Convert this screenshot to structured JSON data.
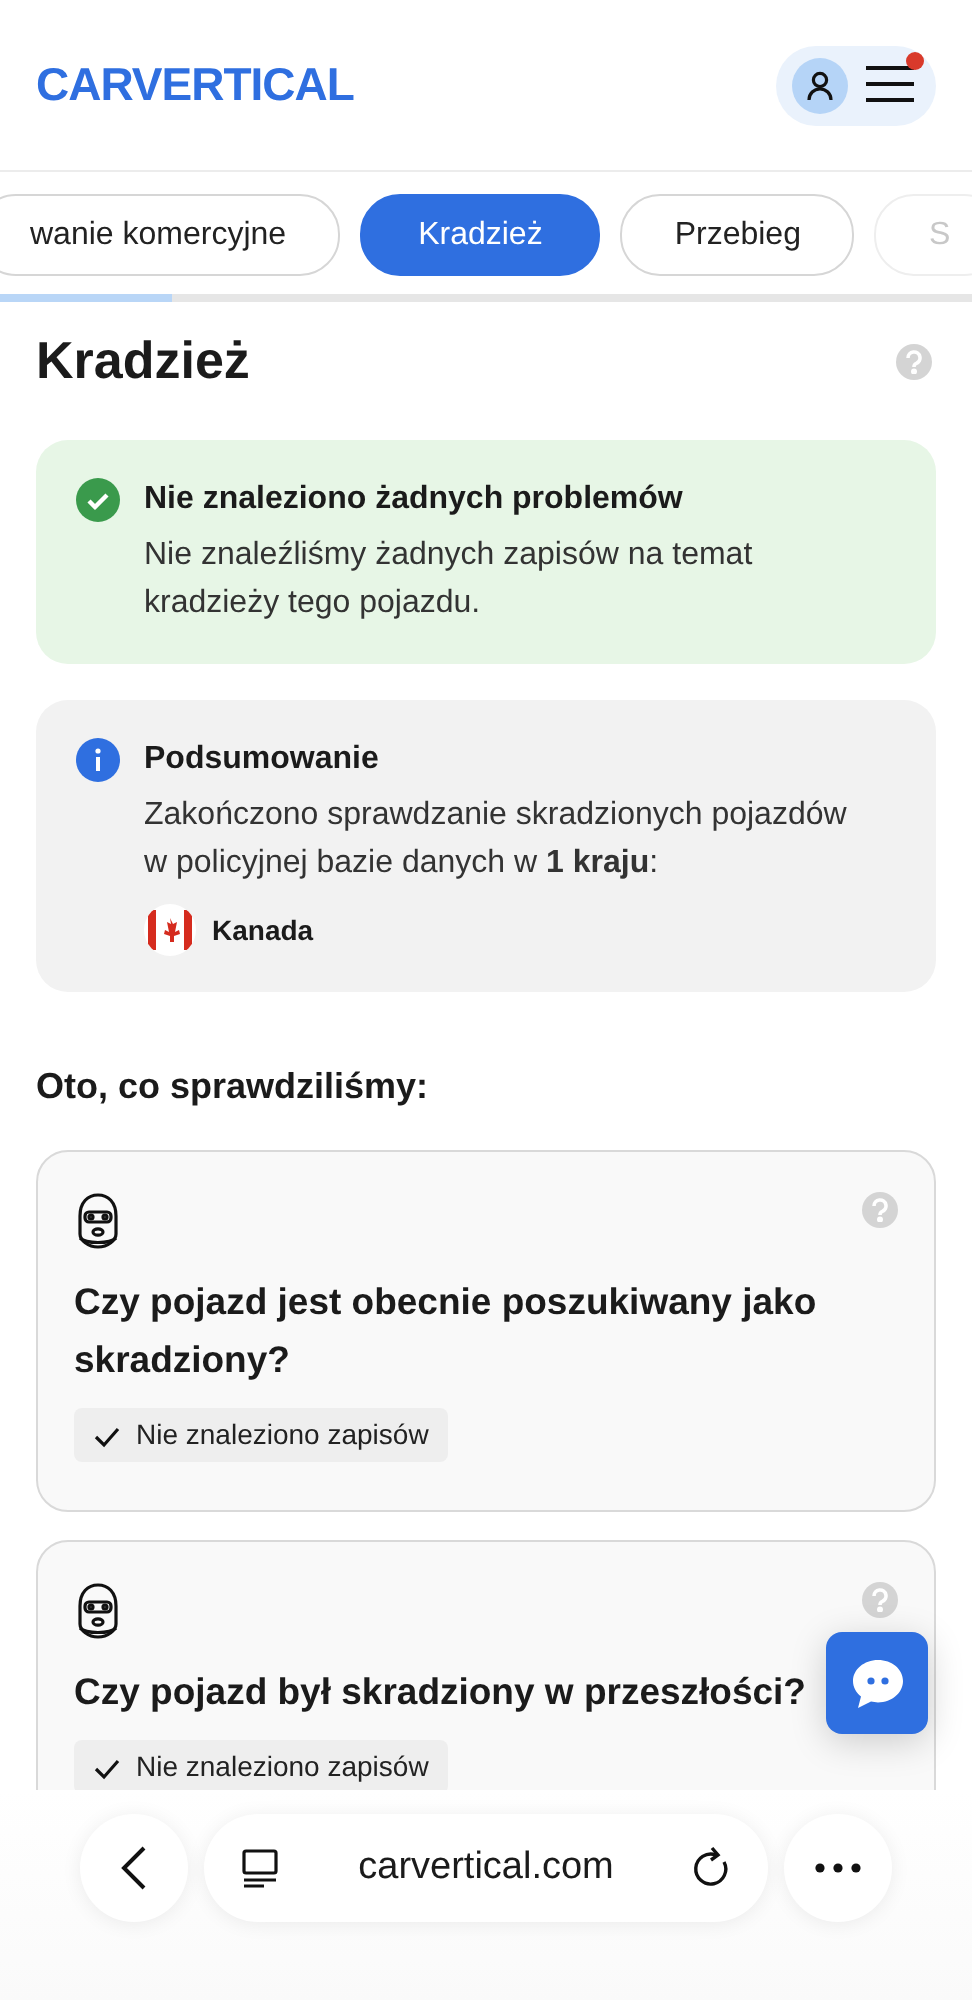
{
  "header": {
    "logo": "CARVERTICAL",
    "notification": true
  },
  "tabs": [
    {
      "label": "wanie komercyjne",
      "selected": false
    },
    {
      "label": "Kradzież",
      "selected": true
    },
    {
      "label": "Przebieg",
      "selected": false
    },
    {
      "label": "S",
      "selected": false
    }
  ],
  "section": {
    "title": "Kradzież"
  },
  "alerts": [
    {
      "kind": "success",
      "title": "Nie znaleziono żadnych problemów",
      "text": "Nie znaleźliśmy żadnych zapisów na temat kradzieży tego pojazdu."
    },
    {
      "kind": "info",
      "title": "Podsumowanie",
      "text": "Zakończono sprawdzanie skradzionych pojazdów w policyjnej bazie danych w **1 kraju**:",
      "countries": [
        "Kanada"
      ]
    }
  ],
  "checked_heading": "Oto, co sprawdziliśmy:",
  "checks": [
    {
      "question": "Czy pojazd jest obecnie poszukiwany jako skradziony?",
      "result": "Nie znaleziono zapisów"
    },
    {
      "question": "Czy pojazd był skradziony w przeszłości?",
      "result": "Nie znaleziono zapisów"
    }
  ],
  "browser_bar": {
    "url": "carvertical.com"
  }
}
